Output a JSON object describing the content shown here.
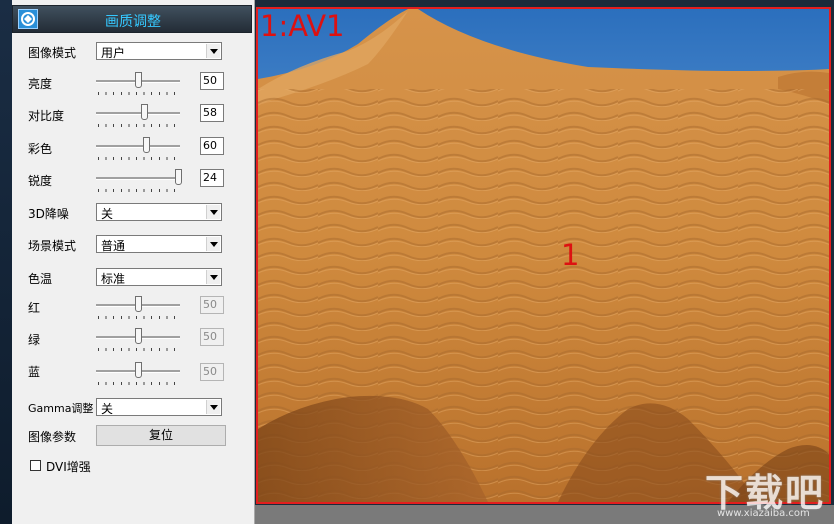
{
  "panel": {
    "title": "画质调整",
    "image_mode": {
      "label": "图像模式",
      "value": "用户"
    },
    "brightness": {
      "label": "亮度",
      "value": "50",
      "level": 50
    },
    "contrast": {
      "label": "对比度",
      "value": "58",
      "level": 58
    },
    "saturation": {
      "label": "彩色",
      "value": "60",
      "level": 60
    },
    "sharpness": {
      "label": "锐度",
      "value": "24",
      "level": 100
    },
    "denoise_3d": {
      "label": "3D降噪",
      "value": "关"
    },
    "scene_mode": {
      "label": "场景模式",
      "value": "普通"
    },
    "color_temp": {
      "label": "色温",
      "value": "标准"
    },
    "red": {
      "label": "红",
      "value": "50",
      "level": 50
    },
    "green": {
      "label": "绿",
      "value": "50",
      "level": 50
    },
    "blue": {
      "label": "蓝",
      "value": "50",
      "level": 50
    },
    "gamma": {
      "label": "Gamma调整",
      "value": "关"
    },
    "image_params": {
      "label": "图像参数",
      "button": "复位"
    },
    "dvi_enhance": {
      "label": "DVI增强",
      "checked": false
    }
  },
  "video": {
    "channel_label": "1:AV1",
    "channel_number": "1",
    "border_color": "#e31e1e"
  },
  "watermark": {
    "big": "下载吧",
    "small": "www.xiazaiba.com"
  }
}
